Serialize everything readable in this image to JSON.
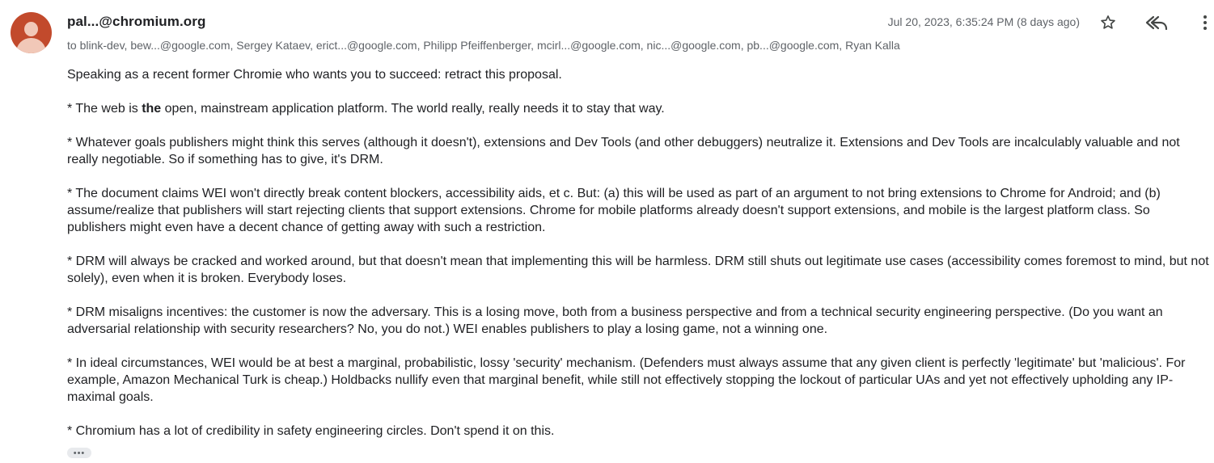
{
  "message": {
    "sender": "pal...@chromium.org",
    "recipients": "to blink-dev, bew...@google.com, Sergey Kataev, erict...@google.com, Philipp Pfeiffenberger, mcirl...@google.com, nic...@google.com, pb...@google.com, Ryan Kalla",
    "date": "Jul 20, 2023, 6:35:24 PM (8 days ago)",
    "body": {
      "p1": "Speaking as a recent former Chromie who wants you to succeed: retract this proposal.",
      "p2_pre": "* The web is ",
      "p2_bold": "the",
      "p2_post": " open, mainstream application platform. The world really, really needs it to stay that way.",
      "p3": "* Whatever goals publishers might think this serves (although it doesn't), extensions and Dev Tools (and other debuggers) neutralize it. Extensions and Dev Tools are incalculably valuable and not really negotiable. So if something has to give, it's DRM.",
      "p4": "* The document claims WEI won't directly break content blockers, accessibility aids, et c. But: (a) this will be used as part of an argument to not bring extensions to Chrome for Android; and (b) assume/realize that publishers will start rejecting clients that support extensions. Chrome for mobile platforms already doesn't support extensions, and mobile is the largest platform class. So publishers might even have a decent chance of getting away with such a restriction.",
      "p5": "* DRM will always be cracked and worked around, but that doesn't mean that implementing this will be harmless. DRM still shuts out legitimate use cases (accessibility comes foremost to mind, but not solely), even when it is broken. Everybody loses.",
      "p6": "* DRM misaligns incentives: the customer is now the adversary. This is a losing move, both from a business perspective and from a technical security engineering perspective. (Do you want an adversarial relationship with security researchers? No, you do not.) WEI enables publishers to play a losing game, not a winning one.",
      "p7": "* In ideal circumstances, WEI would be at best a marginal, probabilistic, lossy 'security' mechanism. (Defenders must always assume that any given client is perfectly 'legitimate' but 'malicious'. For example, Amazon Mechanical Turk is cheap.) Holdbacks nullify even that marginal benefit, while still not effectively stopping the lockout of particular UAs and yet not effectively upholding any IP-maximal goals.",
      "p8": "* Chromium has a lot of credibility in safety engineering circles. Don't spend it on this."
    },
    "trimmed_label": "•••"
  },
  "icons": {
    "star": "star-icon",
    "reply_all": "reply-all-icon",
    "more": "more-vert-icon",
    "avatar": "default-avatar"
  },
  "colors": {
    "avatar_bg": "#c24a2c",
    "avatar_fg": "#f1c8b8",
    "text": "#202124",
    "meta": "#5f6368"
  }
}
